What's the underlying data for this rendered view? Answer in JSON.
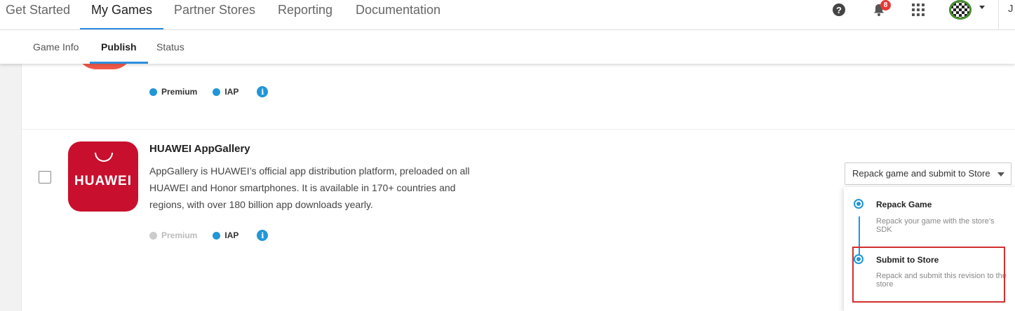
{
  "nav": {
    "tabs": [
      {
        "label": "Get Started"
      },
      {
        "label": "My Games"
      },
      {
        "label": "Partner Stores"
      },
      {
        "label": "Reporting"
      },
      {
        "label": "Documentation"
      }
    ],
    "notification_count": "8",
    "user_initial": "J"
  },
  "subnav": {
    "tabs": [
      {
        "label": "Game Info"
      },
      {
        "label": "Publish"
      },
      {
        "label": "Status"
      }
    ]
  },
  "previous_store": {
    "tags": {
      "premium": "Premium",
      "iap": "IAP"
    }
  },
  "store": {
    "name": "HUAWEI AppGallery",
    "logo_text": "HUAWEI",
    "description": "AppGallery is HUAWEI’s official app distribution platform, preloaded on all HUAWEI and Honor smartphones. It is available in 170+ countries and regions, with over 180 billion app downloads yearly.",
    "tags": {
      "premium": "Premium",
      "iap": "IAP"
    },
    "action_select": "Repack game and submit to Store",
    "steps": [
      {
        "title": "Repack Game",
        "desc": "Repack your game with the store’s SDK"
      },
      {
        "title": "Submit to Store",
        "desc": "Repack and submit this revision to the store"
      }
    ]
  },
  "colors": {
    "accent": "#2196d8",
    "huawei_red": "#c8102e",
    "highlight": "#d32f2f"
  }
}
